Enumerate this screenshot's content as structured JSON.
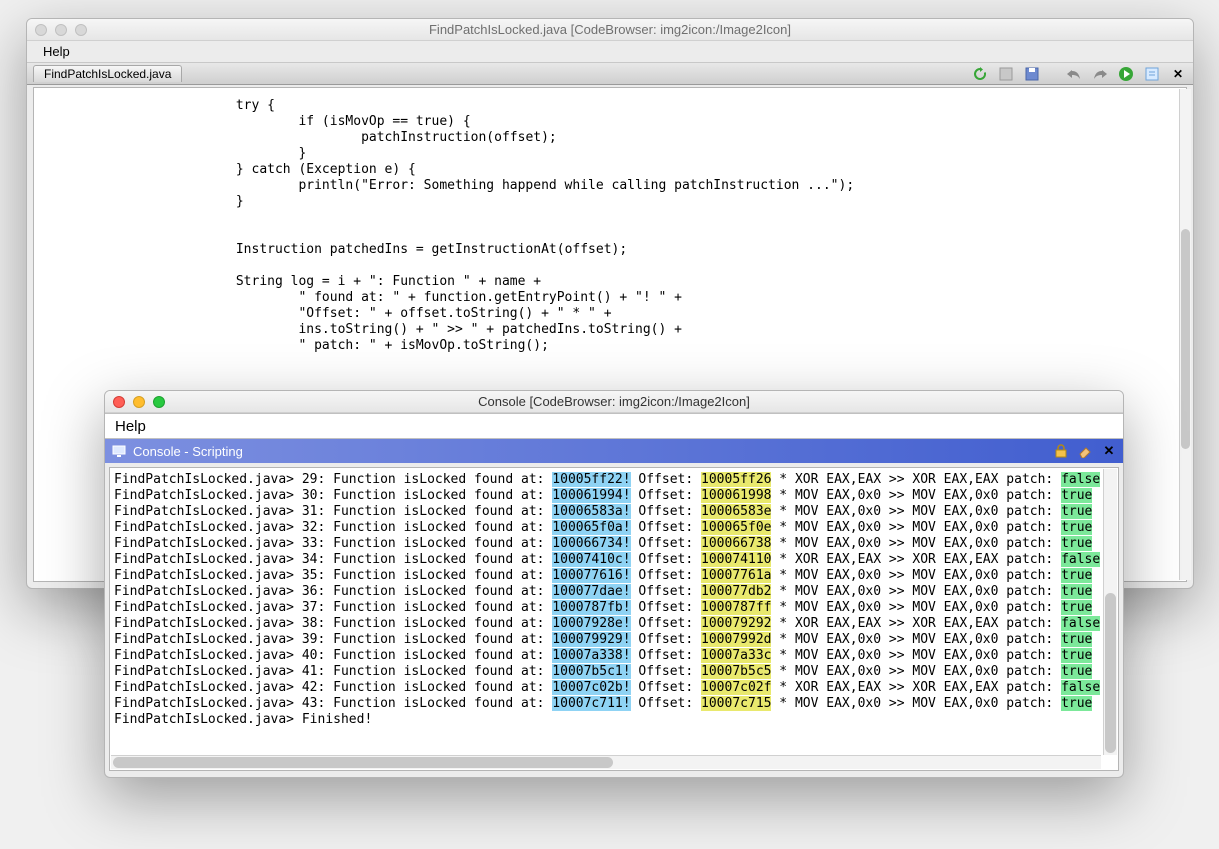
{
  "main_window": {
    "title": "FindPatchIsLocked.java [CodeBrowser: img2icon:/Image2Icon]",
    "menubar": {
      "help": "Help"
    },
    "tab_label": "FindPatchIsLocked.java",
    "code": "\t\t\ttry {\n\t\t\t\tif (isMovOp == true) {\n\t\t\t\t\tpatchInstruction(offset);\n\t\t\t\t}\n\t\t\t} catch (Exception e) {\n\t\t\t\tprintln(\"Error: Something happend while calling patchInstruction ...\");\n\t\t\t}\n\n\n\t\t\tInstruction patchedIns = getInstructionAt(offset);\n\n\t\t\tString log = i + \": Function \" + name +\n\t\t\t\t\" found at: \" + function.getEntryPoint() + \"! \" +\n\t\t\t\t\"Offset: \" + offset.toString() + \" * \" +\n\t\t\t\tins.toString() + \" >> \" + patchedIns.toString() +\n\t\t\t\t\" patch: \" + isMovOp.toString();\n\n\n\n\n\t}\n\n\tprivat"
  },
  "console_window": {
    "title": "Console [CodeBrowser: img2icon:/Image2Icon]",
    "menubar": {
      "help": "Help"
    },
    "header": "Console - Scripting",
    "prompt": "FindPatchIsLocked.java>",
    "finished": "Finished!",
    "rows": [
      {
        "n": "29",
        "fn": "isLocked",
        "addr": "10005ff22",
        "off": "10005ff26",
        "ins": "XOR EAX,EAX >> XOR EAX,EAX",
        "patch": "false"
      },
      {
        "n": "30",
        "fn": "isLocked",
        "addr": "100061994",
        "off": "100061998",
        "ins": "MOV EAX,0x0 >> MOV EAX,0x0",
        "patch": "true"
      },
      {
        "n": "31",
        "fn": "isLocked",
        "addr": "10006583a",
        "off": "10006583e",
        "ins": "MOV EAX,0x0 >> MOV EAX,0x0",
        "patch": "true"
      },
      {
        "n": "32",
        "fn": "isLocked",
        "addr": "100065f0a",
        "off": "100065f0e",
        "ins": "MOV EAX,0x0 >> MOV EAX,0x0",
        "patch": "true"
      },
      {
        "n": "33",
        "fn": "isLocked",
        "addr": "100066734",
        "off": "100066738",
        "ins": "MOV EAX,0x0 >> MOV EAX,0x0",
        "patch": "true"
      },
      {
        "n": "34",
        "fn": "isLocked",
        "addr": "10007410c",
        "off": "100074110",
        "ins": "XOR EAX,EAX >> XOR EAX,EAX",
        "patch": "false"
      },
      {
        "n": "35",
        "fn": "isLocked",
        "addr": "100077616",
        "off": "10007761a",
        "ins": "MOV EAX,0x0 >> MOV EAX,0x0",
        "patch": "true"
      },
      {
        "n": "36",
        "fn": "isLocked",
        "addr": "100077dae",
        "off": "100077db2",
        "ins": "MOV EAX,0x0 >> MOV EAX,0x0",
        "patch": "true"
      },
      {
        "n": "37",
        "fn": "isLocked",
        "addr": "1000787fb",
        "off": "1000787ff",
        "ins": "MOV EAX,0x0 >> MOV EAX,0x0",
        "patch": "true"
      },
      {
        "n": "38",
        "fn": "isLocked",
        "addr": "10007928e",
        "off": "100079292",
        "ins": "XOR EAX,EAX >> XOR EAX,EAX",
        "patch": "false"
      },
      {
        "n": "39",
        "fn": "isLocked",
        "addr": "100079929",
        "off": "10007992d",
        "ins": "MOV EAX,0x0 >> MOV EAX,0x0",
        "patch": "true"
      },
      {
        "n": "40",
        "fn": "isLocked",
        "addr": "10007a338",
        "off": "10007a33c",
        "ins": "MOV EAX,0x0 >> MOV EAX,0x0",
        "patch": "true"
      },
      {
        "n": "41",
        "fn": "isLocked",
        "addr": "10007b5c1",
        "off": "10007b5c5",
        "ins": "MOV EAX,0x0 >> MOV EAX,0x0",
        "patch": "true"
      },
      {
        "n": "42",
        "fn": "isLocked",
        "addr": "10007c02b",
        "off": "10007c02f",
        "ins": "XOR EAX,EAX >> XOR EAX,EAX",
        "patch": "false"
      },
      {
        "n": "43",
        "fn": "isLocked",
        "addr": "10007c711",
        "off": "10007c715",
        "ins": "MOV EAX,0x0 >> MOV EAX,0x0",
        "patch": "true"
      }
    ]
  }
}
